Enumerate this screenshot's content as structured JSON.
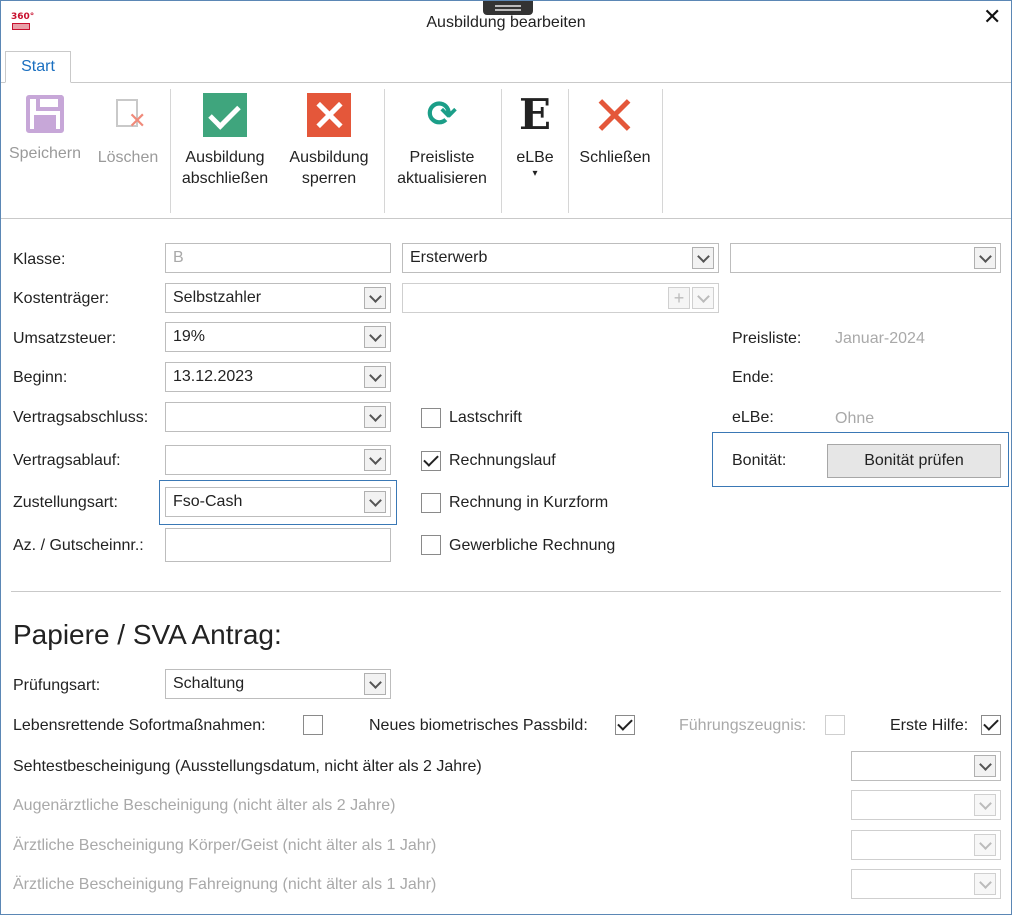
{
  "window": {
    "title": "Ausbildung bearbeiten",
    "close_glyph": "✕",
    "logo_text": "360°"
  },
  "tabs": [
    {
      "label": "Start"
    }
  ],
  "ribbon": {
    "save": {
      "label": "Speichern",
      "icon": "save-icon"
    },
    "delete": {
      "label": "Löschen",
      "icon": "delete-icon"
    },
    "finish": {
      "label1": "Ausbildung",
      "label2": "abschließen",
      "icon": "check-icon"
    },
    "block": {
      "label1": "Ausbildung",
      "label2": "sperren",
      "icon": "block-icon"
    },
    "pricelist": {
      "label1": "Preisliste",
      "label2": "aktualisieren",
      "icon": "refresh-icon",
      "glyph": "⟳"
    },
    "elbe": {
      "label": "eLBe",
      "icon": "elbe-icon",
      "glyph": "E",
      "caret": "▾"
    },
    "close": {
      "label": "Schließen",
      "icon": "close-icon"
    }
  },
  "form": {
    "klasse": {
      "label": "Klasse:",
      "value": "B"
    },
    "erwerb": {
      "value": "Ersterwerb"
    },
    "extra": {
      "value": ""
    },
    "kostentraeger": {
      "label": "Kostenträger:",
      "value": "Selbstzahler"
    },
    "kosten_extra": {
      "value": "",
      "plus": "+"
    },
    "umsatzsteuer": {
      "label": "Umsatzsteuer:",
      "value": "19%"
    },
    "beginn": {
      "label": "Beginn:",
      "value": "13.12.2023"
    },
    "vertragsabschluss": {
      "label": "Vertragsabschluss:",
      "value": ""
    },
    "vertragsablauf": {
      "label": "Vertragsablauf:",
      "value": ""
    },
    "zustellungsart": {
      "label": "Zustellungsart:",
      "value": "Fso-Cash"
    },
    "gutschein": {
      "label": "Az. / Gutscheinnr.:",
      "value": ""
    },
    "lastschrift": {
      "label": "Lastschrift",
      "checked": false
    },
    "rechnungslauf": {
      "label": "Rechnungslauf",
      "checked": true
    },
    "kurzform": {
      "label": "Rechnung in Kurzform",
      "checked": false
    },
    "gewerblich": {
      "label": "Gewerbliche Rechnung",
      "checked": false
    },
    "preisliste": {
      "label": "Preisliste:",
      "value": "Januar-2024"
    },
    "ende": {
      "label": "Ende:",
      "value": ""
    },
    "elbe": {
      "label": "eLBe:",
      "value": "Ohne"
    },
    "bonitaet": {
      "label": "Bonität:",
      "button": "Bonität prüfen"
    }
  },
  "papers": {
    "title": "Papiere / SVA Antrag:",
    "pruefungsart": {
      "label": "Prüfungsart:",
      "value": "Schaltung"
    },
    "sofort": {
      "label": "Lebensrettende Sofortmaßnahmen:",
      "checked": false
    },
    "passbild": {
      "label": "Neues biometrisches Passbild:",
      "checked": true
    },
    "fuehrung": {
      "label": "Führungszeugnis:",
      "checked": false
    },
    "erstehilfe": {
      "label": "Erste Hilfe:",
      "checked": true
    },
    "sehtest": {
      "label": "Sehtestbescheinigung (Ausstellungsdatum, nicht älter als 2 Jahre)"
    },
    "augen": {
      "label": "Augenärztliche Bescheinigung (nicht älter als 2 Jahre)"
    },
    "koerper": {
      "label": "Ärztliche Bescheinigung Körper/Geist (nicht älter als 1 Jahr)"
    },
    "fahreignung": {
      "label": "Ärztliche Bescheinigung Fahreignung (nicht älter als 1 Jahr)"
    }
  }
}
